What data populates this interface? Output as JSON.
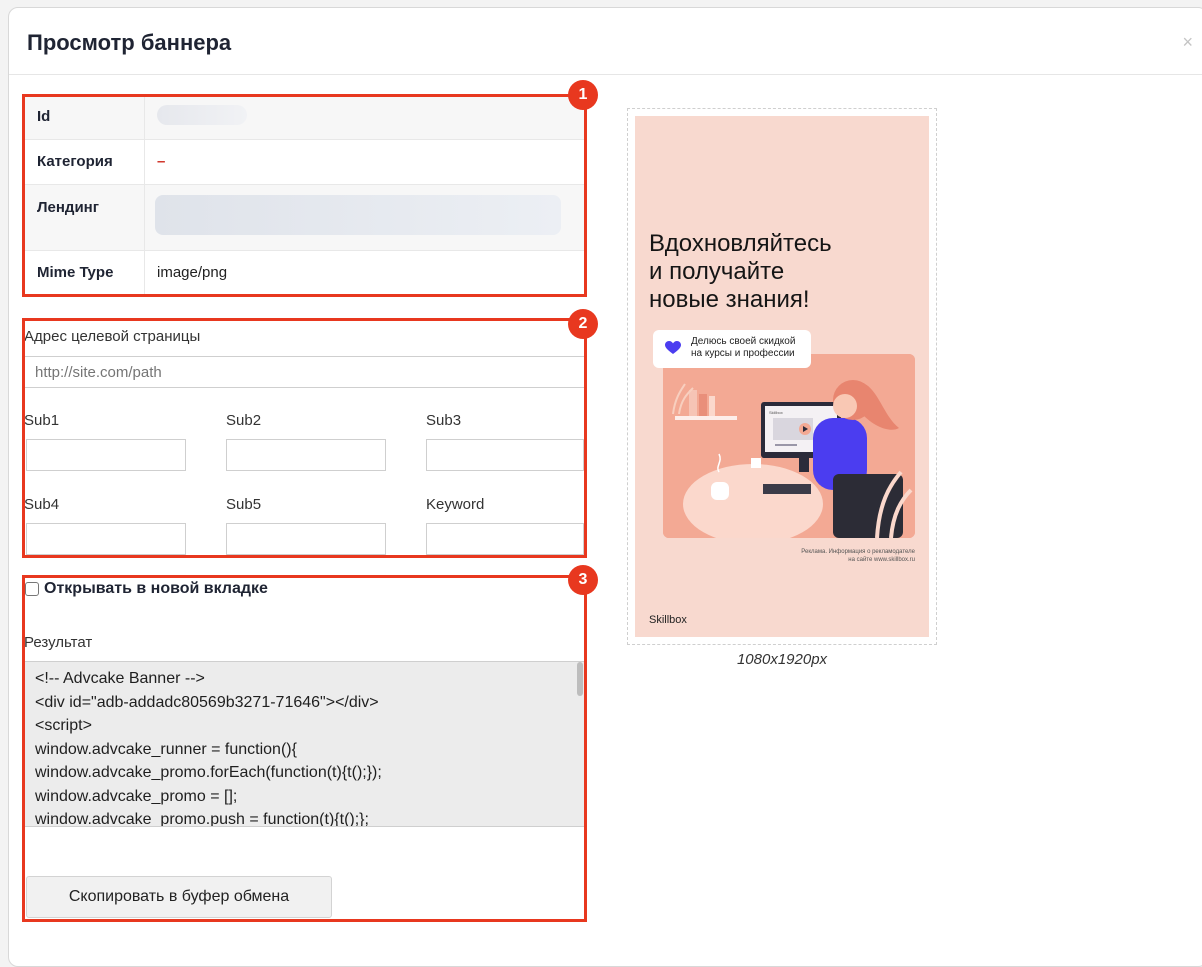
{
  "dialog": {
    "title": "Просмотр баннера",
    "close_glyph": "×"
  },
  "badges": [
    "1",
    "2",
    "3"
  ],
  "info": {
    "rows": [
      {
        "key": "Id",
        "value": ""
      },
      {
        "key": "Категория",
        "value": "–"
      },
      {
        "key": "Лендинг",
        "value": ""
      },
      {
        "key": "Mime Type",
        "value": "image/png"
      }
    ]
  },
  "form": {
    "target_url_label": "Адрес целевой страницы",
    "target_url_placeholder": "http://site.com/path",
    "subs": [
      "Sub1",
      "Sub2",
      "Sub3",
      "Sub4",
      "Sub5",
      "Keyword"
    ]
  },
  "options": {
    "new_tab_label": "Открывать в новой вкладке",
    "new_tab_checked": false
  },
  "result": {
    "label": "Результат",
    "code_lines": [
      "<!-- Advcake Banner -->",
      "<div id=\"adb-addadc80569b3271-71646\"></div>",
      "<script>",
      "window.advcake_runner = function(){",
      "window.advcake_promo.forEach(function(t){t();});",
      "window.advcake_promo = [];",
      "window.advcake_promo.push = function(t){t();};"
    ],
    "copy_button": "Скопировать в буфер обмена"
  },
  "preview": {
    "headline": [
      "Вдохновляйтесь",
      "и получайте",
      "новые знания!"
    ],
    "tag_lines": [
      "Делюсь своей скидкой",
      "на курсы и профессии"
    ],
    "screen_label": "Skillbox",
    "legal_lines": [
      "Реклама. Информация о рекламодателе",
      "на сайте www.skillbox.ru"
    ],
    "brand": "Skillbox",
    "size_caption": "1080x1920px"
  },
  "colors": {
    "annotation": "#e8381f",
    "banner_bg": "#f8d9cf",
    "accent_blue": "#4b3df0"
  }
}
